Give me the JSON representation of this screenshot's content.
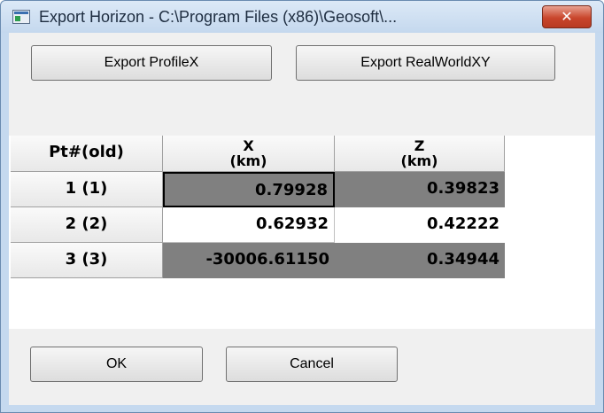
{
  "window": {
    "title": "Export Horizon - C:\\Program Files (x86)\\Geosoft\\...",
    "close_glyph": "✕"
  },
  "toolbar": {
    "export_profilex_label": "Export ProfileX",
    "export_realworldxy_label": "Export RealWorldXY"
  },
  "table": {
    "corner_header": "Pt#(old)",
    "columns": [
      {
        "name": "X",
        "unit": "(km)"
      },
      {
        "name": "Z",
        "unit": "(km)"
      }
    ],
    "rows": [
      {
        "label": "1 (1)",
        "x": "0.79928",
        "z": "0.39823"
      },
      {
        "label": "2 (2)",
        "x": "0.62932",
        "z": "0.42222"
      },
      {
        "label": "3 (3)",
        "x": "-30006.61150",
        "z": "0.34944"
      }
    ]
  },
  "footer": {
    "ok_label": "OK",
    "cancel_label": "Cancel"
  },
  "colors": {
    "title_bar": "#c4d8ee",
    "close_button": "#c9462c",
    "highlight_cell": "#808080",
    "cell_text": "#000000"
  },
  "icons": {
    "app": "app-window-icon",
    "close": "close-icon"
  }
}
